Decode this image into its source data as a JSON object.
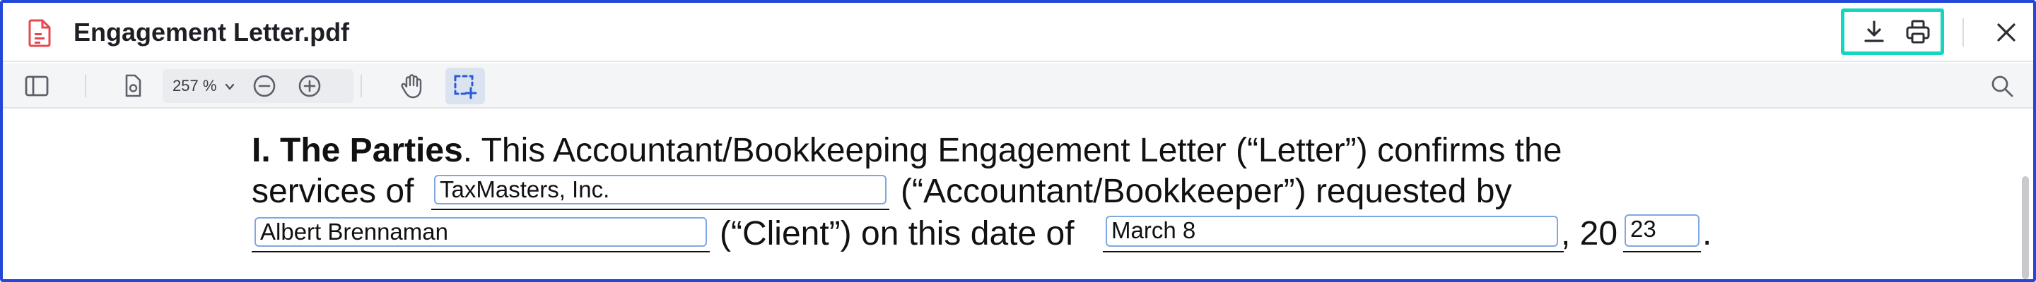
{
  "window": {
    "title": "Engagement Letter.pdf",
    "icons": {
      "file": "pdf-file-icon",
      "download": "download-icon",
      "print": "print-icon",
      "close": "close-icon"
    }
  },
  "toolbar": {
    "zoom_label": "257 %",
    "icons": [
      "sidebar-toggle-icon",
      "page-settings-icon",
      "chevron-down-icon",
      "zoom-out-icon",
      "zoom-in-icon",
      "hand-tool-icon",
      "select-tool-icon",
      "search-icon"
    ]
  },
  "document": {
    "line1_bold": "I. The Parties",
    "line1_rest": ". This Accountant/Bookkeeping Engagement Letter (“Letter”) confirms the",
    "line2_start": "services of",
    "line2_end": "(“Accountant/Bookkeeper”) requested by",
    "line3_mid": "(“Client”) on this date of",
    "line3_year_prefix": ", 20",
    "line3_period": ".",
    "fields": {
      "accountant": "TaxMasters, Inc.",
      "client": "Albert Brennaman",
      "date": "March 8",
      "year": "23"
    }
  },
  "colors": {
    "frame_border": "#2347d8",
    "highlight_border": "#13d6c1",
    "pdf_icon": "#e5484d",
    "field_border": "#7fa7e0",
    "selected_tool_bg": "#dce3f0",
    "selected_tool_icon": "#2a5bd7"
  }
}
